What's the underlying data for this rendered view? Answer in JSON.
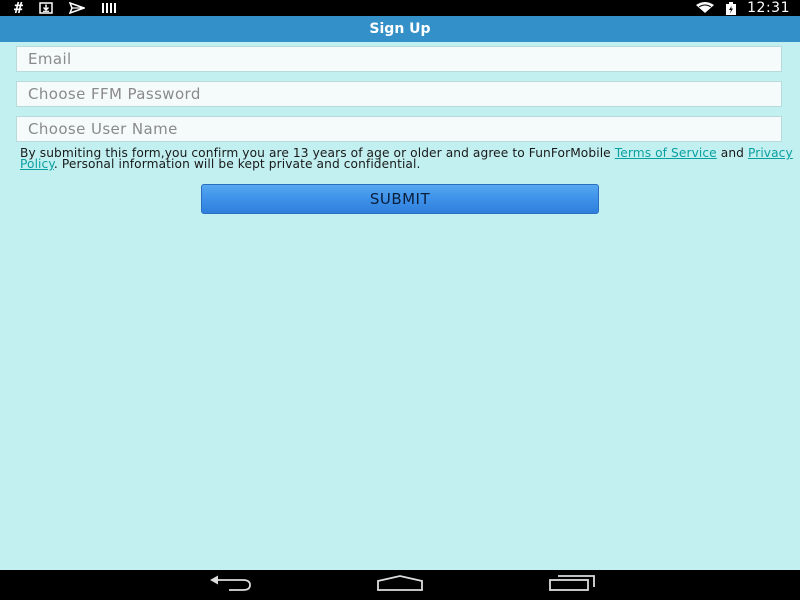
{
  "status_bar": {
    "left_icons": [
      "hash-icon",
      "download-icon",
      "send-icon",
      "barcode-icon"
    ],
    "hash_glyph": "#",
    "right_icons": [
      "wifi-icon",
      "battery-icon"
    ],
    "time": "12:31"
  },
  "header": {
    "title": "Sign Up",
    "bg_color": "#3390c8"
  },
  "form": {
    "email": {
      "placeholder": "Email",
      "value": ""
    },
    "password": {
      "placeholder": "Choose FFM Password",
      "value": ""
    },
    "username": {
      "placeholder": "Choose User Name",
      "value": ""
    },
    "disclaimer": {
      "text_before": "By submiting this form,you confirm you are 13 years of age or older and agree to FunForMobile ",
      "terms_link": "Terms of Service",
      "text_middle": " and ",
      "privacy_link": "Privacy Policy",
      "text_after": ". Personal information will be kept private and confidential."
    },
    "submit_label": "SUBMIT"
  },
  "nav_bar": {
    "buttons": [
      "back-icon",
      "home-icon",
      "recents-icon"
    ]
  },
  "colors": {
    "background": "#c2eff0",
    "link": "#0aa0a0",
    "button": "#3f93ea"
  }
}
